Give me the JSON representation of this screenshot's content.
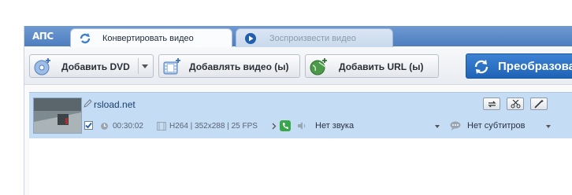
{
  "app": {
    "logo_text": "AΠC"
  },
  "tabs": [
    {
      "label": "Конвертировать видео",
      "icon": "convert-tab-icon",
      "active": true
    },
    {
      "label": "Зоспроизвести видео",
      "icon": "play-icon",
      "active": false
    }
  ],
  "toolbar": {
    "add_dvd": "Добавить DVD",
    "add_video": "Добавлять видео (ы)",
    "add_url": "Добавить URL (ы)",
    "convert": "Преобразовать"
  },
  "file": {
    "name": "rsload.net",
    "duration": "00:30:02",
    "video_info": "H264 | 352x288 | 25 FPS",
    "audio": "Нет звука",
    "subtitles": "Нет субтитров",
    "checked": true
  },
  "colors": {
    "accent": "#2f72c7",
    "tabbar": "#5d8bc9",
    "row_selected": "#c5dcf5"
  }
}
